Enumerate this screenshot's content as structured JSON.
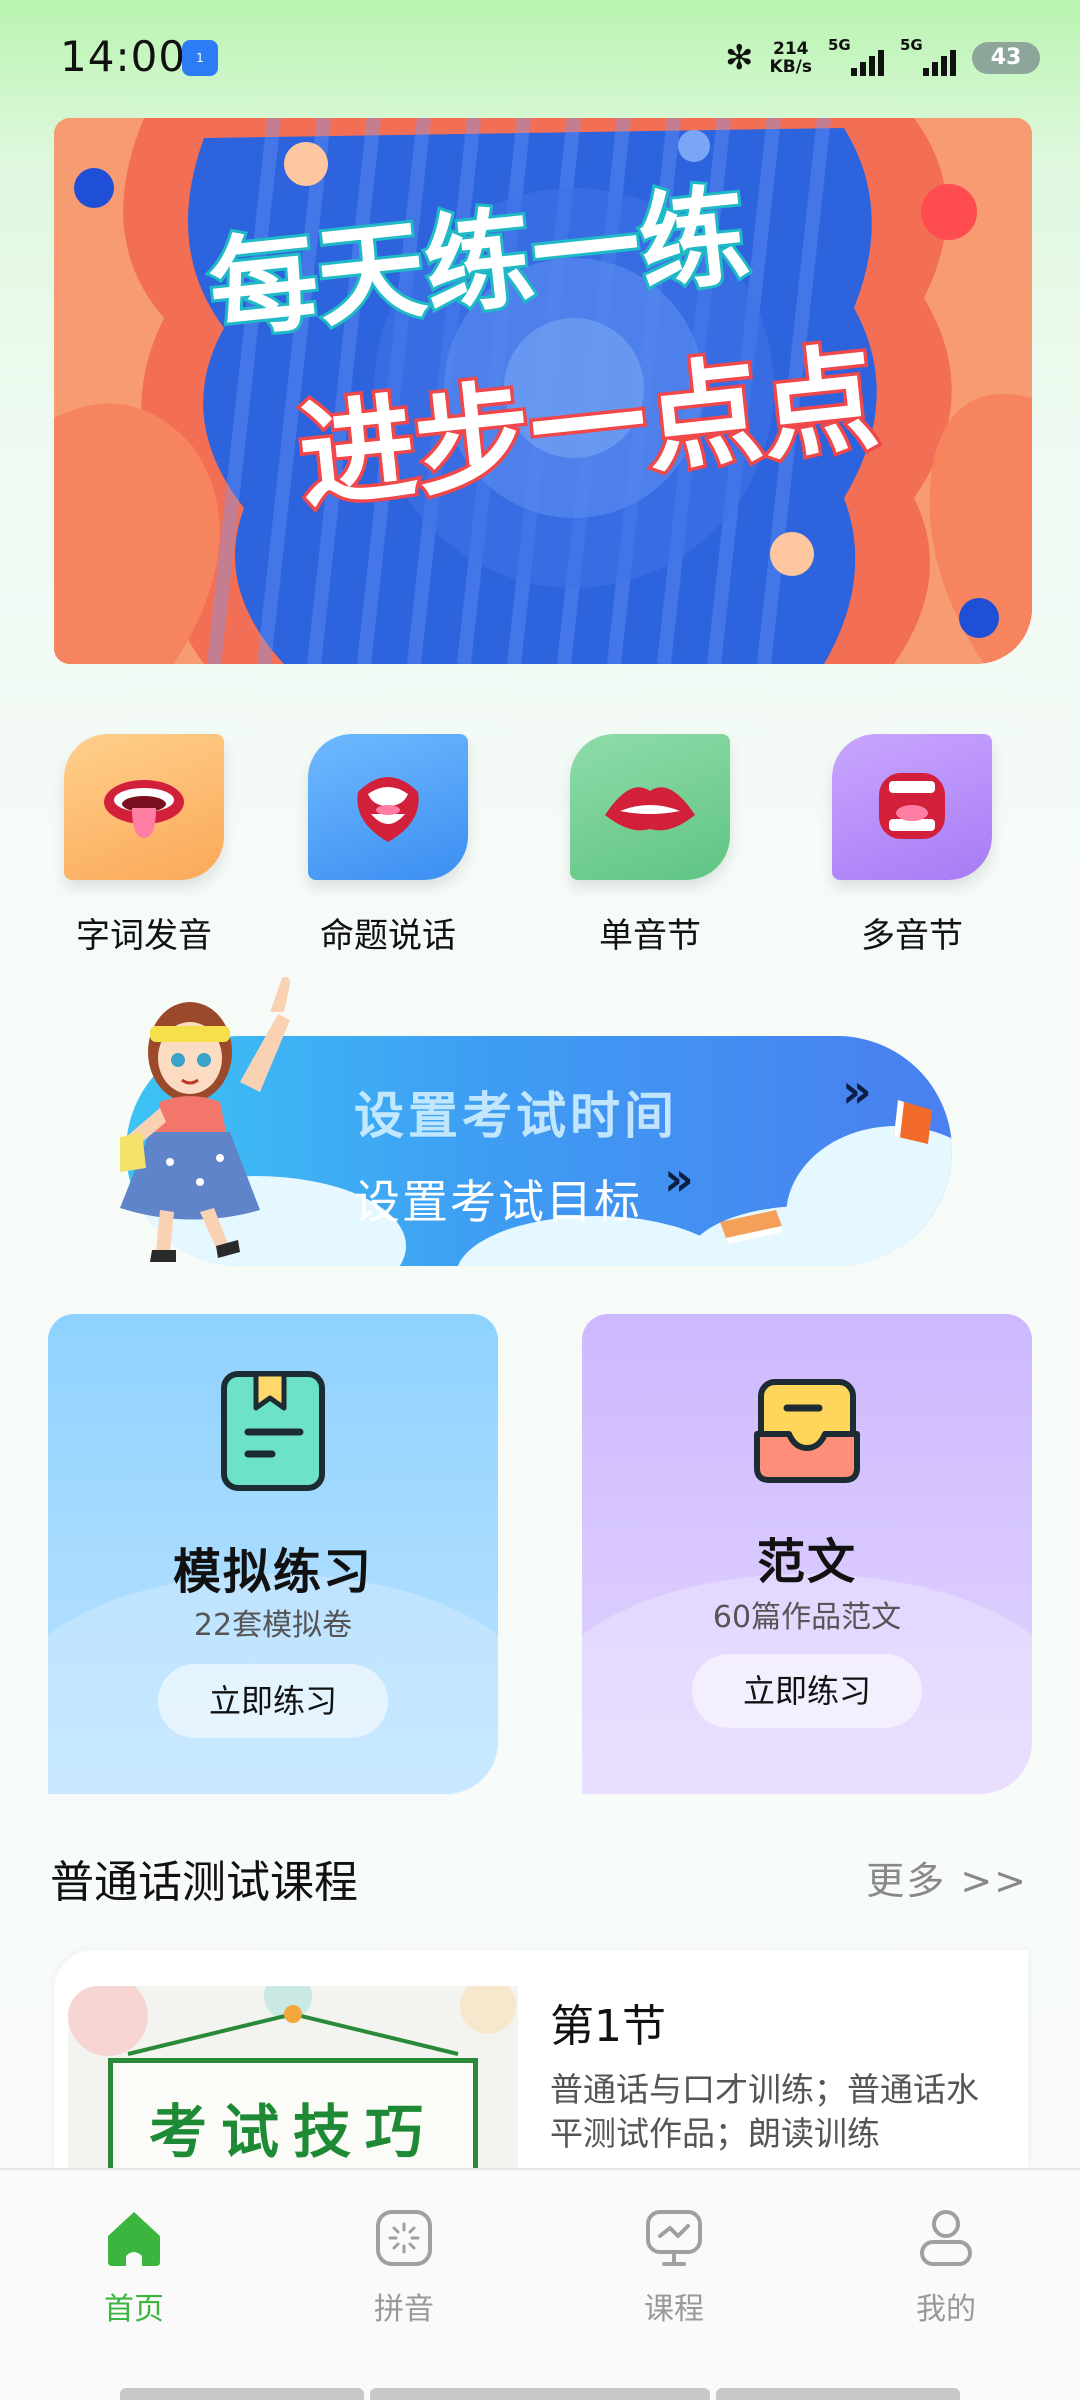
{
  "status_bar": {
    "time": "14:00",
    "notification_badge": "1",
    "net_speed_value": "214",
    "net_speed_unit": "KB/s",
    "signal1_label": "5G",
    "signal2_label": "5G",
    "battery": "43",
    "bluetooth_icon": "bluetooth-icon"
  },
  "banner": {
    "line1": "每天练一练",
    "line2": "进步一点点"
  },
  "categories": [
    {
      "label": "字词发音",
      "color": "#fbb16a",
      "icon": "mouth-tongue-icon"
    },
    {
      "label": "命题说话",
      "color": "#4aa2f5",
      "icon": "mouth-talking-icon"
    },
    {
      "label": "单音节",
      "color": "#6fcf8f",
      "icon": "lips-icon"
    },
    {
      "label": "多音节",
      "color": "#b58cf7",
      "icon": "mouth-shout-icon"
    }
  ],
  "exam_banner": {
    "title": "设置考试时间",
    "target": "设置考试目标",
    "arrow": "»"
  },
  "cards": [
    {
      "title": "模拟练习",
      "subtitle": "22套模拟卷",
      "button": "立即练习",
      "icon": "clipboard-icon"
    },
    {
      "title": "范文",
      "subtitle": "60篇作品范文",
      "button": "立即练习",
      "icon": "inbox-icon"
    }
  ],
  "course_section": {
    "title": "普通话测试课程",
    "more": "更多 >>"
  },
  "course": {
    "thumbnail_text": "考试技巧",
    "lesson_title": "第1节",
    "lesson_desc": "普通话与口才训练；普通话水平测试作品；朗读训练"
  },
  "bottom_nav": [
    {
      "label": "首页",
      "icon": "home-icon",
      "active": true
    },
    {
      "label": "拼音",
      "icon": "pinyin-icon",
      "active": false
    },
    {
      "label": "课程",
      "icon": "course-icon",
      "active": false
    },
    {
      "label": "我的",
      "icon": "profile-icon",
      "active": false
    }
  ],
  "colors": {
    "accent": "#3bb53e",
    "nav_inactive": "#999999"
  }
}
